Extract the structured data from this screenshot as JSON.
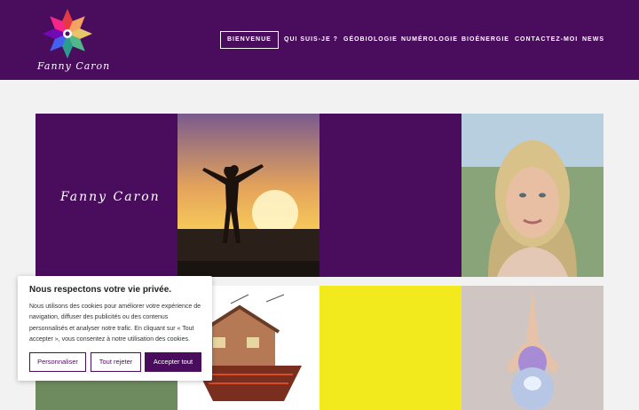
{
  "colors": {
    "brand": "#4a0d5e",
    "yellow": "#f2ea1c",
    "green": "#6e8a5f"
  },
  "header": {
    "logo_text": "Fanny Caron",
    "nav": [
      {
        "label": "BIENVENUE",
        "active": true
      },
      {
        "label": "QUI SUIS-JE ?",
        "active": false
      },
      {
        "label": "GÉOBIOLOGIE",
        "active": false
      },
      {
        "label": "NUMÉROLOGIE",
        "active": false
      },
      {
        "label": "BIOÉNERGIE",
        "active": false
      },
      {
        "label": "CONTACTEZ-MOI",
        "active": false
      },
      {
        "label": "NEWS",
        "active": false
      }
    ]
  },
  "grid": {
    "name_tile_text": "Fanny Caron"
  },
  "cookie": {
    "title": "Nous respectons votre vie privée.",
    "text": "Nous utilisons des cookies pour améliorer votre expérience de navigation, diffuser des publicités ou des contenus personnalisés et analyser notre trafic. En cliquant sur « Tout accepter », vous consentez à notre utilisation des cookies.",
    "btn_customize": "Personnaliser",
    "btn_reject": "Tout rejeter",
    "btn_accept": "Accepter tout"
  }
}
